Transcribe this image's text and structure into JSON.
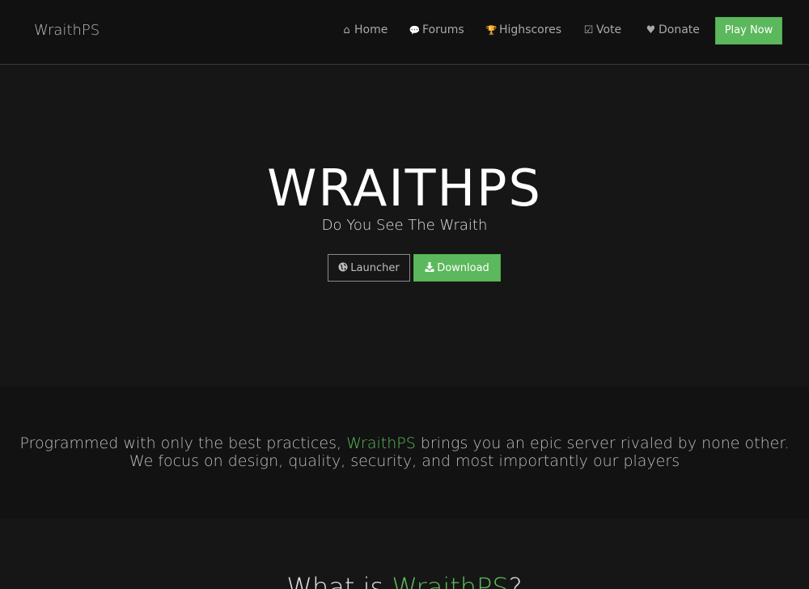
{
  "navbar": {
    "brand": "WraithPS",
    "items": [
      {
        "label": "Home",
        "icon": "home-icon",
        "glyph": "⌂"
      },
      {
        "label": "Forums",
        "icon": "comments-icon",
        "glyph": "💬"
      },
      {
        "label": "Highscores",
        "icon": "trophy-icon",
        "glyph": "🏆"
      },
      {
        "label": "Vote",
        "icon": "check-square-icon",
        "glyph": "☑"
      },
      {
        "label": "Donate",
        "icon": "heart-icon",
        "glyph": "♥"
      }
    ],
    "play_button": "Play Now"
  },
  "hero": {
    "title": "WRAITHPS",
    "subtitle": "Do You See The Wraith",
    "launcher_label": "Launcher",
    "launcher_icon": "globe-icon",
    "download_label": "Download",
    "download_icon": "download-icon"
  },
  "tagline": {
    "line1_pre": "Programmed with only the best practices, ",
    "line1_accent": "WraithPS",
    "line1_post": " brings you an epic server rivaled by none other.",
    "line2": "We focus on design, quality, security, and most importantly our players"
  },
  "section": {
    "title_pre": "What is ",
    "title_accent": "WraithPS",
    "title_post": "?"
  },
  "colors": {
    "accent": "#5cb85c",
    "background": "#161616",
    "navbar": "#111111"
  }
}
